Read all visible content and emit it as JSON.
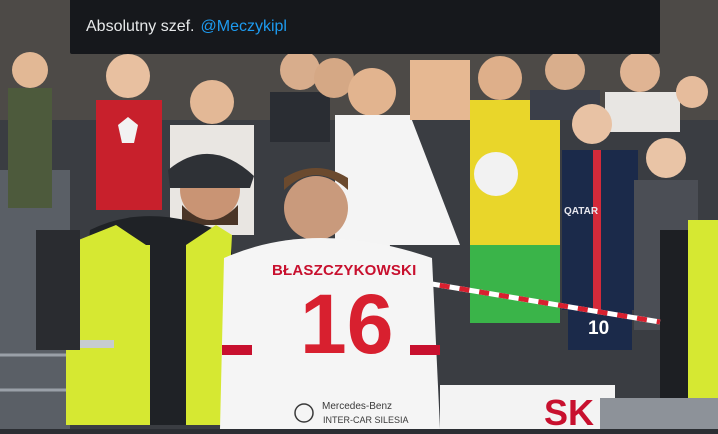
{
  "tweet": {
    "text": "Absolutny szef.",
    "mention": "@Meczykipl"
  },
  "photo": {
    "player_name": "BŁASZCZYKOWSKI",
    "player_number": "16",
    "sponsor_line1": "Mercedes-Benz",
    "sponsor_line2": "INTER-CAR SILESIA",
    "kid_number": "10",
    "kid_sponsor": "QATAR",
    "banner_fragment": "SK"
  },
  "colors": {
    "tweet_bg": "#16181c",
    "mention": "#1d9bf0",
    "jersey_red": "#c8102e",
    "vest_yellow": "#d6e832",
    "psg_navy": "#1b2a4a"
  }
}
